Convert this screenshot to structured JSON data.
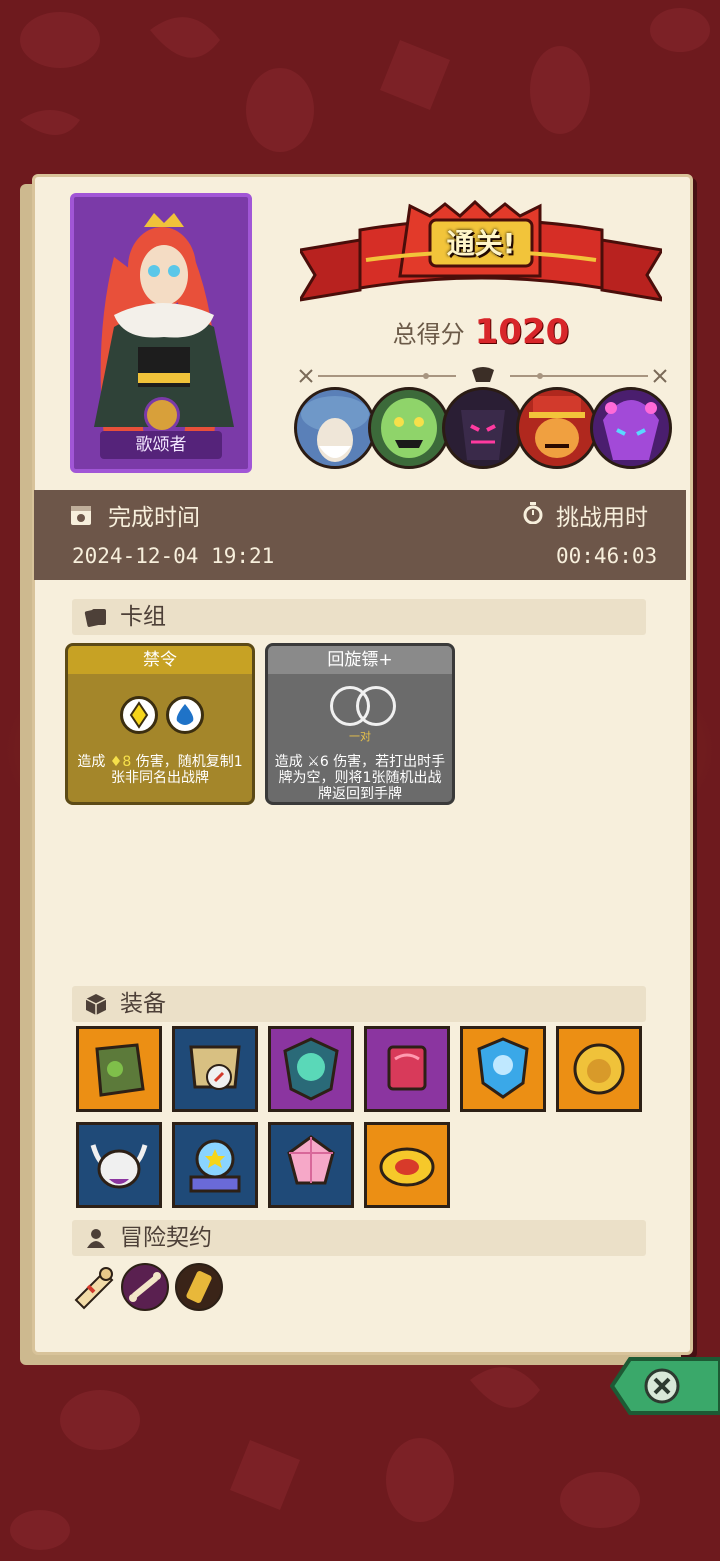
{
  "hero": {
    "name": "歌颂者"
  },
  "result": {
    "banner": "通关!",
    "score_label": "总得分",
    "score_value": "1020"
  },
  "bosses": [
    {
      "name": "mushroom-elder",
      "color": "#6f98c8"
    },
    {
      "name": "goblin-green",
      "color": "#8fd46a"
    },
    {
      "name": "shadow-knight",
      "color": "#5b3a78"
    },
    {
      "name": "red-hat-warlord",
      "color": "#d23a2c"
    },
    {
      "name": "void-demon",
      "color": "#a24ad8"
    }
  ],
  "time": {
    "completion_label": "完成时间",
    "completion_value": "2024-12-04 19:21",
    "challenge_label": "挑战用时",
    "challenge_value": "00:46:03"
  },
  "deck": {
    "title": "卡组",
    "cards": [
      {
        "name": "禁令",
        "desc_prefix": "造成",
        "desc_value": "8",
        "desc_suffix": "伤害，随机复制1张非同名出战牌"
      },
      {
        "name": "回旋镖+",
        "pair_label": "一对",
        "desc_prefix": "造成",
        "desc_value": "6",
        "desc_suffix": "伤害，若打出时手牌为空，则将1张随机出战牌返回到手牌"
      }
    ]
  },
  "equipment": {
    "title": "装备",
    "items": [
      {
        "icon": "mossy-stone-icon",
        "bg": "orange"
      },
      {
        "icon": "armor-compass-icon",
        "bg": "blue"
      },
      {
        "icon": "demon-mask-shield-icon",
        "bg": "purple"
      },
      {
        "icon": "flesh-cube-icon",
        "bg": "purple"
      },
      {
        "icon": "ice-skull-shield-icon",
        "bg": "orange"
      },
      {
        "icon": "lion-ring-icon",
        "bg": "orange"
      },
      {
        "icon": "horned-skull-icon",
        "bg": "blue"
      },
      {
        "icon": "star-crystal-ball-icon",
        "bg": "blue"
      },
      {
        "icon": "pink-gem-icon",
        "bg": "blue"
      },
      {
        "icon": "golden-crown-ring-icon",
        "bg": "orange"
      }
    ]
  },
  "contract": {
    "title": "冒险契约",
    "items": [
      "scroll-icon",
      "bone-icon",
      "golden-bone-icon"
    ]
  }
}
